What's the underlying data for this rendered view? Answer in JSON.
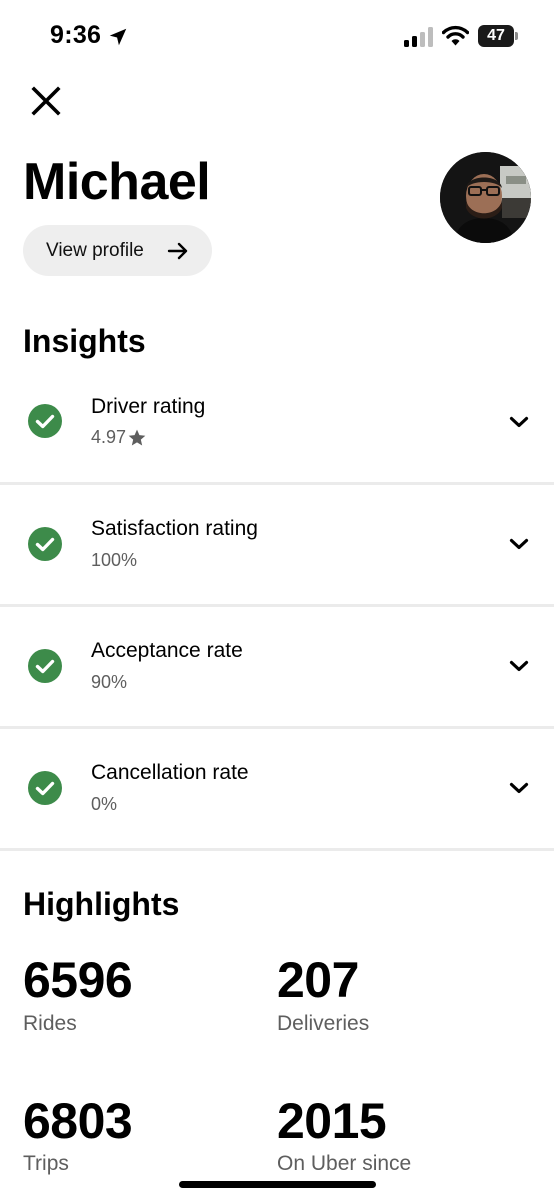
{
  "status_bar": {
    "time": "9:36",
    "battery": "47",
    "icons": [
      "location-arrow-icon",
      "cellular-signal-icon",
      "wifi-icon",
      "battery-icon"
    ]
  },
  "header": {
    "close_icon": "close-icon",
    "name": "Michael",
    "view_profile_label": "View profile",
    "view_profile_icon": "arrow-right-icon"
  },
  "insights": {
    "title": "Insights",
    "items": [
      {
        "label": "Driver rating",
        "value": "4.97",
        "value_icon": "star-icon"
      },
      {
        "label": "Satisfaction rating",
        "value": "100%"
      },
      {
        "label": "Acceptance rate",
        "value": "90%"
      },
      {
        "label": "Cancellation rate",
        "value": "0%"
      }
    ]
  },
  "highlights": {
    "title": "Highlights",
    "stats": [
      {
        "value": "6596",
        "label": "Rides"
      },
      {
        "value": "207",
        "label": "Deliveries"
      },
      {
        "value": "6803",
        "label": "Trips"
      },
      {
        "value": "2015",
        "label": "On Uber since"
      }
    ]
  },
  "colors": {
    "check_green": "#3d8b4a",
    "secondary_text": "#5e5e5e",
    "pill_bg": "#eeeeee",
    "divider": "#ebebeb"
  }
}
